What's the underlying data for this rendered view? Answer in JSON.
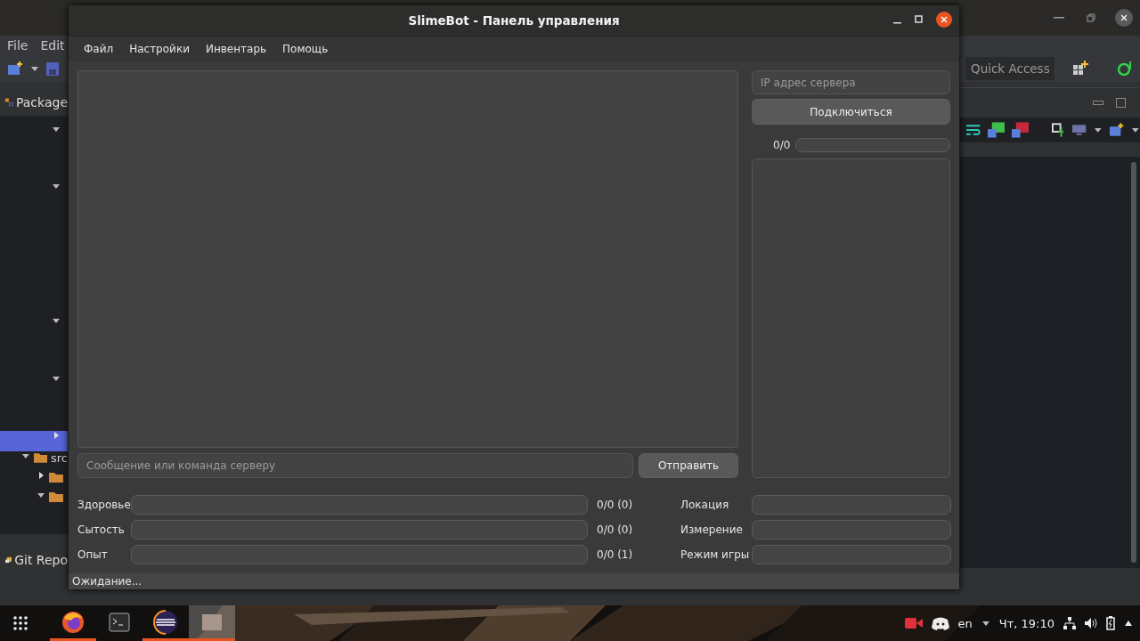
{
  "background_window": {
    "menu": [
      "File",
      "Edit"
    ],
    "package_panel": {
      "title": "Package"
    },
    "tree": [
      {
        "expanded": true,
        "selected": false
      },
      {
        "expanded": true,
        "selected": false
      },
      {
        "expanded": true,
        "selected": false
      },
      {
        "expanded": true,
        "selected": false
      },
      {
        "expanded": false,
        "selected": true
      }
    ],
    "src": {
      "label": "src",
      "expanded": true,
      "children": [
        {
          "expanded": false
        },
        {
          "expanded": true
        }
      ]
    },
    "git_panel": {
      "title": "Git Repo"
    },
    "quick_access": {
      "placeholder": "Quick Access"
    }
  },
  "window": {
    "title": "SlimeBot - Панель управления"
  },
  "menu": [
    "Файл",
    "Настройки",
    "Инвентарь",
    "Помощь"
  ],
  "message": {
    "placeholder": "Сообщение или команда серверу"
  },
  "send_button": "Отправить",
  "server": {
    "placeholder": "IP адрес сервера",
    "connect_button": "Подключиться",
    "progress_text": "0/0",
    "level": 0
  },
  "stats": [
    {
      "label": "Здоровье",
      "level": 0,
      "reading": "0/0 (0)"
    },
    {
      "label": "Сытость",
      "level": 0,
      "reading": "0/0 (0)"
    },
    {
      "label": "Опыт",
      "level": 0,
      "reading": "0/0 (1)"
    }
  ],
  "info": [
    {
      "label": "Локация"
    },
    {
      "label": "Измерение"
    },
    {
      "label": "Режим игры"
    }
  ],
  "status_bar": "Ожидание...",
  "taskbar": {
    "apps": [
      {
        "kind": "firefox",
        "running": true
      },
      {
        "kind": "terminal",
        "running": false
      },
      {
        "kind": "eclipse",
        "running": true
      },
      {
        "kind": "window",
        "running": true
      }
    ],
    "language": "en",
    "clock": "Чт, 19:10"
  }
}
